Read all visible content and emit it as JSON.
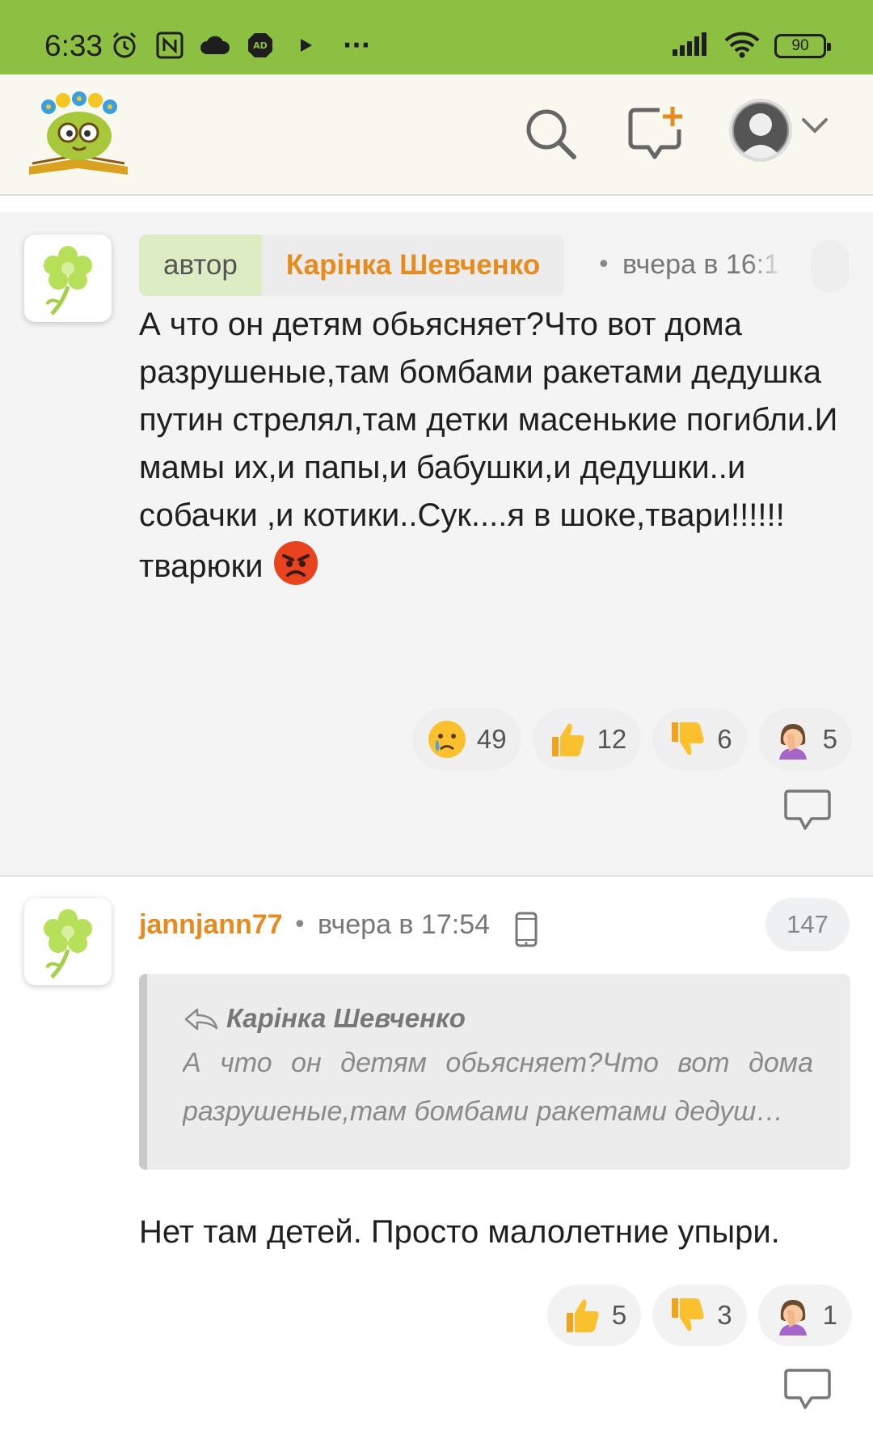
{
  "status_bar": {
    "time": "6:33",
    "battery": "90",
    "icons": [
      "alarm-icon",
      "nfc-icon",
      "cloud-icon",
      "adblock-icon",
      "play-icon",
      "more-icon",
      "signal-icon",
      "wifi-icon",
      "battery-icon"
    ],
    "more_label": "···",
    "adblock_label": "AD"
  },
  "header": {
    "logo": "site-logo",
    "icons": [
      "search-icon",
      "new-message-icon",
      "user-avatar",
      "chevron-down-icon"
    ]
  },
  "comments": [
    {
      "author_tag": "автор",
      "author": "Карінка Шевченко",
      "dot": "•",
      "time": "вчера в 16:1",
      "text": "А что он детям обьясняет?Что вот дома разрушеные,там бомбами ракетами дедушка путин стрелял,там детки масенькие погибли.И мамы их,и папы,и бабушки,и дедушки..и собачки ,и котики..Сук....я в шоке,твари!!!!!!тварюки",
      "reactions": [
        {
          "icon": "crying-face-icon",
          "count": "49"
        },
        {
          "icon": "thumbs-up-icon",
          "count": "12"
        },
        {
          "icon": "thumbs-down-icon",
          "count": "6"
        },
        {
          "icon": "facepalm-icon",
          "count": "5"
        }
      ]
    },
    {
      "author": "jannjann77",
      "dot": "•",
      "time": "вчера в 17:54",
      "count": "147",
      "quote": {
        "author": "Карінка Шевченко",
        "text": "А что он детям обьясняет?Что вот дома разрушеные,там бомбами ракетами дедуш…"
      },
      "text": "Нет там детей. Просто малолетние упыри.",
      "reactions": [
        {
          "icon": "thumbs-up-icon",
          "count": "5"
        },
        {
          "icon": "thumbs-down-icon",
          "count": "3"
        },
        {
          "icon": "facepalm-icon",
          "count": "1"
        }
      ]
    }
  ],
  "colors": {
    "status_bar": "#8dbf43",
    "author_name": "#e88b1e",
    "author_tag_bg": "#dcedc3"
  }
}
